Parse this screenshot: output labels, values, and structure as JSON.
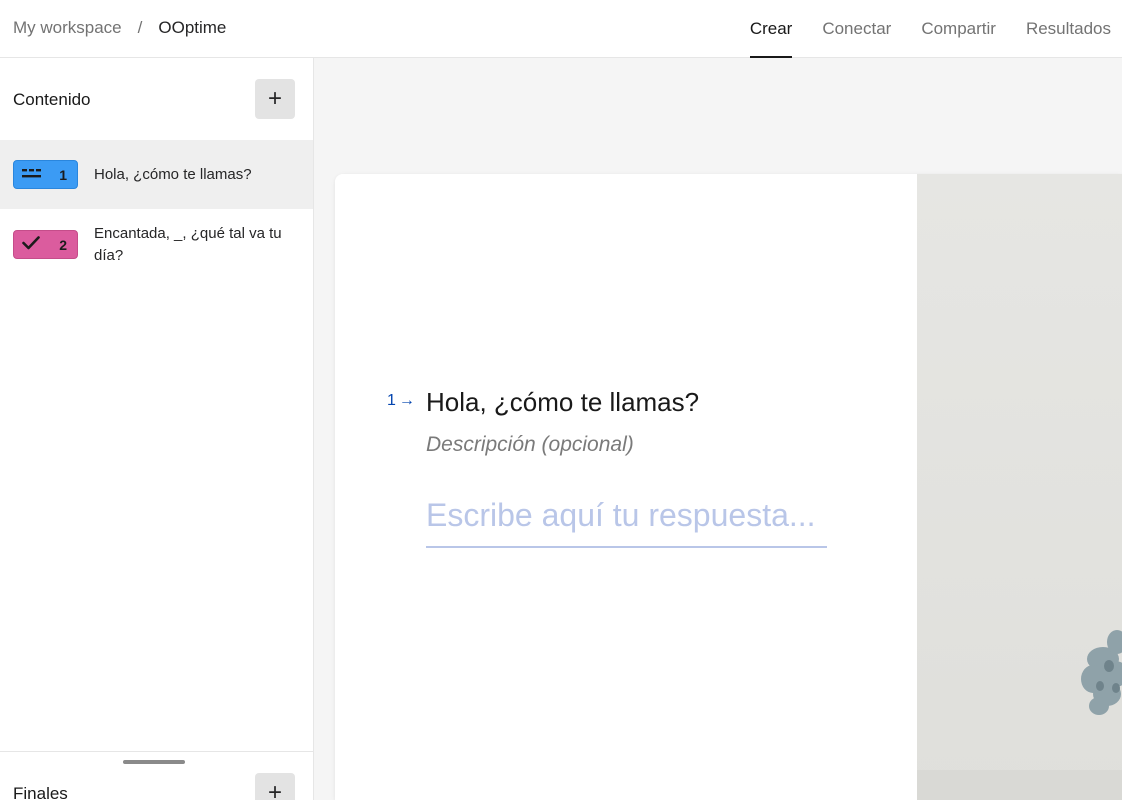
{
  "breadcrumb": {
    "workspace": "My workspace",
    "separator": "/",
    "form_name": "OOptime"
  },
  "tabs": [
    {
      "label": "Crear",
      "active": true
    },
    {
      "label": "Conectar",
      "active": false
    },
    {
      "label": "Compartir",
      "active": false
    },
    {
      "label": "Resultados",
      "active": false
    }
  ],
  "sidebar": {
    "title": "Contenido",
    "add_label": "+",
    "items": [
      {
        "number": "1",
        "icon": "short-text-icon",
        "text": "Hola, ¿cómo te llamas?",
        "color": "#3b9bf4",
        "selected": true
      },
      {
        "number": "2",
        "icon": "checkmark-icon",
        "text": "Encantada, _, ¿qué tal va tu día?",
        "color": "#db5c9e",
        "selected": false
      }
    ],
    "footer_title": "Finales",
    "footer_add_label": "+"
  },
  "question": {
    "number": "1",
    "arrow": "→",
    "title": "Hola, ¿cómo te llamas?",
    "description": "Descripción (opcional)",
    "answer_placeholder": "Escribe aquí tu respuesta...",
    "accent_color": "#0445af"
  }
}
